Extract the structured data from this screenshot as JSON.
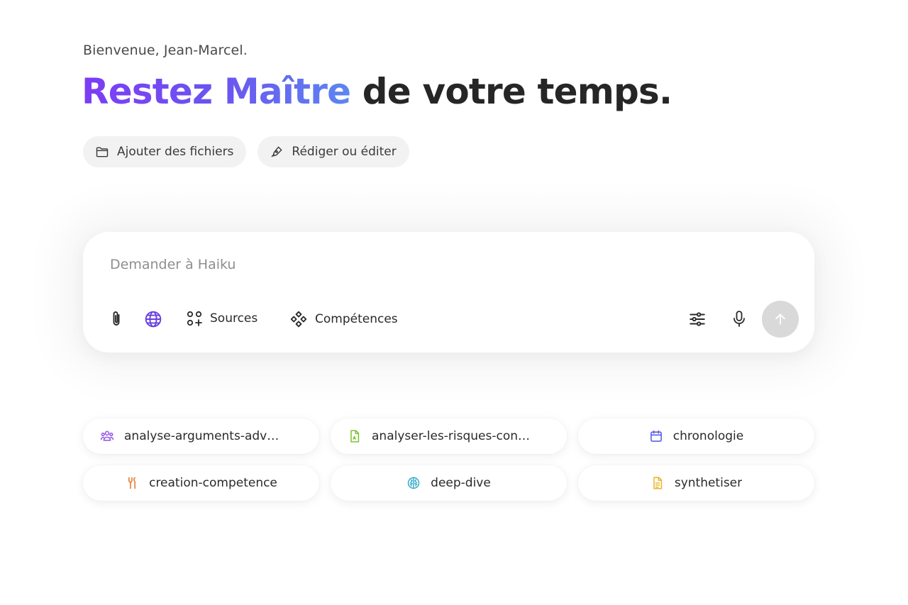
{
  "header": {
    "welcome": "Bienvenue, Jean-Marcel.",
    "headline_accent": "Restez Maître",
    "headline_rest": " de votre temps."
  },
  "quick_actions": [
    {
      "label": "Ajouter des fichiers",
      "icon": "folder-icon"
    },
    {
      "label": "Rédiger ou éditer",
      "icon": "pen-icon"
    }
  ],
  "prompt": {
    "placeholder": "Demander à Haiku",
    "value": "",
    "tools": {
      "sources_label": "Sources",
      "competences_label": "Compétences"
    }
  },
  "suggestions": [
    {
      "label": "analyse-arguments-adv…",
      "icon": "users-icon",
      "color": "#9a5ce6"
    },
    {
      "label": "analyser-les-risques-con…",
      "icon": "document-icon",
      "color": "#7cc232"
    },
    {
      "label": "chronologie",
      "icon": "calendar-icon",
      "color": "#5b5fe0"
    },
    {
      "label": "creation-competence",
      "icon": "tools-icon",
      "color": "#e6792e"
    },
    {
      "label": "deep-dive",
      "icon": "brain-icon",
      "color": "#2ea8c8"
    },
    {
      "label": "synthetiser",
      "icon": "text-document-icon",
      "color": "#e8b52a"
    }
  ],
  "colors": {
    "accent_start": "#7d3cf5",
    "accent_end": "#5d86f0",
    "globe": "#6a3fe0",
    "send_button_bg": "#d9d9d9"
  }
}
